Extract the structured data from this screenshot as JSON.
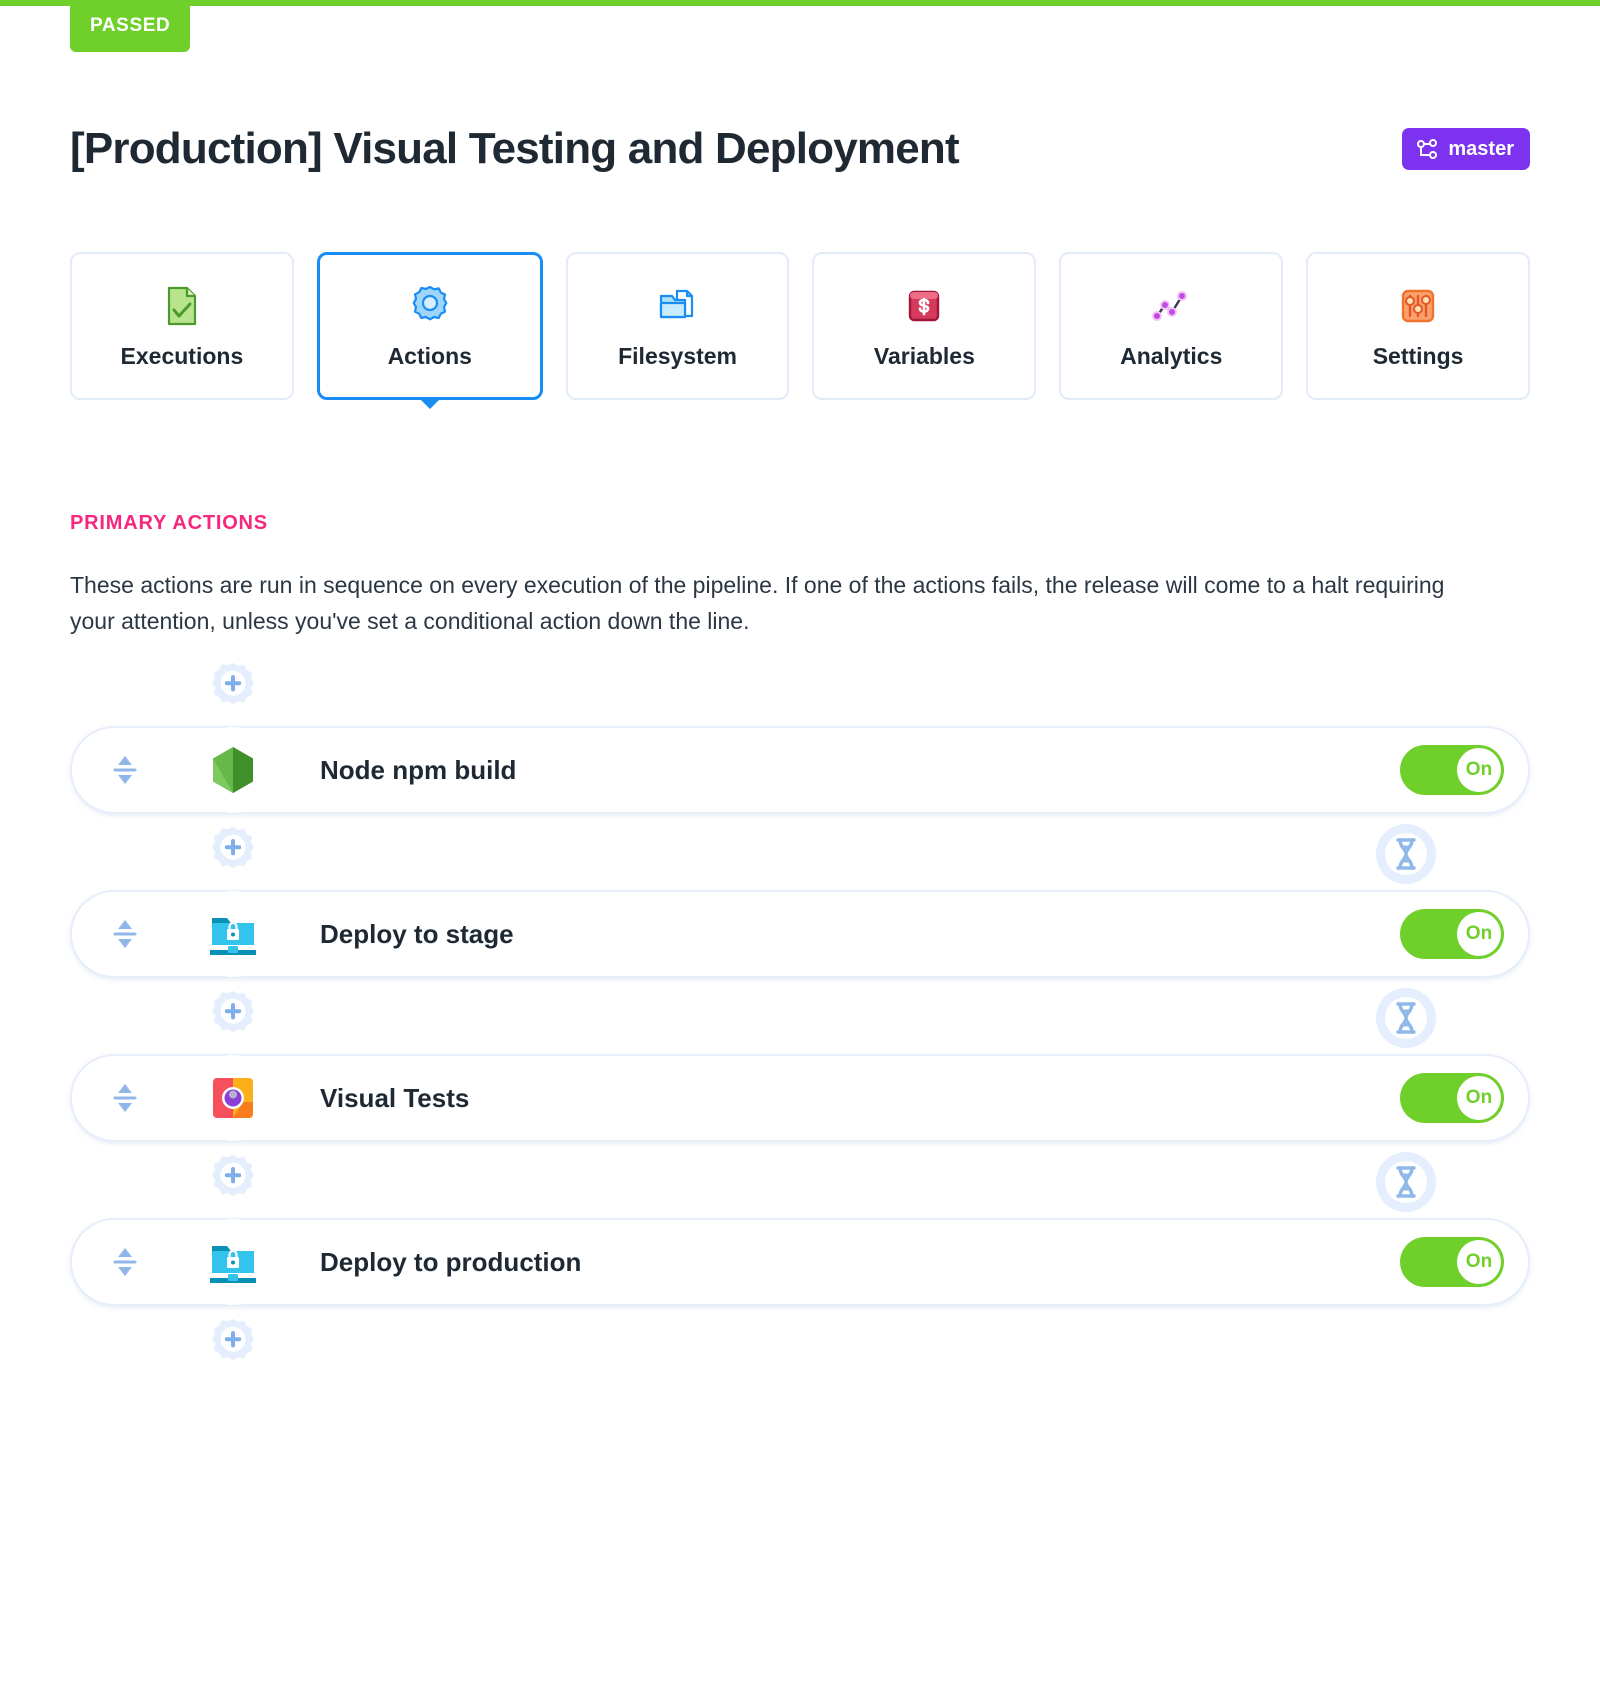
{
  "status": {
    "label": "PASSED",
    "color": "#6fcf2b"
  },
  "header": {
    "title": "[Production] Visual Testing and Deployment",
    "branch": {
      "label": "master",
      "icon": "git-branch-icon",
      "color": "#7c32ef"
    }
  },
  "tabs": [
    {
      "label": "Executions",
      "icon": "document-check-icon",
      "active": false
    },
    {
      "label": "Actions",
      "icon": "gear-icon",
      "active": true
    },
    {
      "label": "Filesystem",
      "icon": "folder-file-icon",
      "active": false
    },
    {
      "label": "Variables",
      "icon": "dollar-card-icon",
      "active": false
    },
    {
      "label": "Analytics",
      "icon": "line-chart-icon",
      "active": false
    },
    {
      "label": "Settings",
      "icon": "sliders-icon",
      "active": false
    }
  ],
  "section": {
    "title": "PRIMARY ACTIONS",
    "title_color": "#f5277f",
    "description": "These actions are run in sequence on every execution of the pipeline. If one of the actions fails, the release will come to a halt requiring your attention, unless you've set a conditional action down the line."
  },
  "pipeline": {
    "add_action_label": "+",
    "toggle_on_label": "On",
    "actions": [
      {
        "name": "Node npm build",
        "icon": "nodejs-icon",
        "toggle": "On",
        "has_wait_after": true
      },
      {
        "name": "Deploy to stage",
        "icon": "sftp-lock-folder-icon",
        "toggle": "On",
        "has_wait_after": true
      },
      {
        "name": "Visual Tests",
        "icon": "visual-tests-icon",
        "toggle": "On",
        "has_wait_after": true
      },
      {
        "name": "Deploy to production",
        "icon": "sftp-lock-folder-icon",
        "toggle": "On",
        "has_wait_after": false
      }
    ]
  }
}
